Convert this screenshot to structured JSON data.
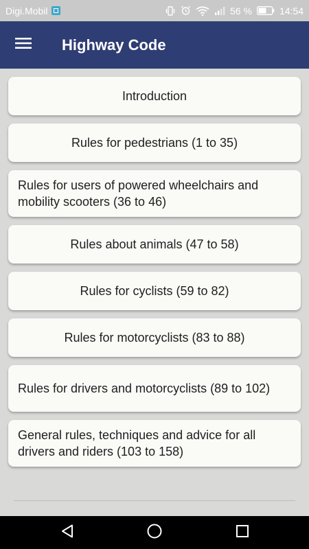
{
  "status_bar": {
    "carrier": "Digi.Mobil",
    "battery_percent": "56 %",
    "time": "14:54"
  },
  "app_bar": {
    "title": "Highway Code"
  },
  "sections": [
    {
      "label": "Introduction"
    },
    {
      "label": "Rules for pedestrians (1 to 35)"
    },
    {
      "label": "Rules for users of powered wheelchairs and mobility scooters (36 to 46)"
    },
    {
      "label": "Rules about animals (47 to 58)"
    },
    {
      "label": "Rules for cyclists (59 to 82)"
    },
    {
      "label": "Rules for motorcyclists (83 to 88)"
    },
    {
      "label": "Rules for drivers and motorcyclists (89 to 102)"
    },
    {
      "label": "General rules, techniques and advice for all drivers and riders (103 to 158)"
    }
  ],
  "icons": {
    "menu": "hamburger-menu-icon",
    "back": "back-triangle-icon",
    "home": "home-circle-icon",
    "recents": "recents-square-icon"
  },
  "colors": {
    "app_bar": "#2e3d73",
    "background": "#d9d9d7",
    "card": "#fafaf7",
    "status_bar": "#c9c9c9",
    "nav_bar": "#000000"
  }
}
